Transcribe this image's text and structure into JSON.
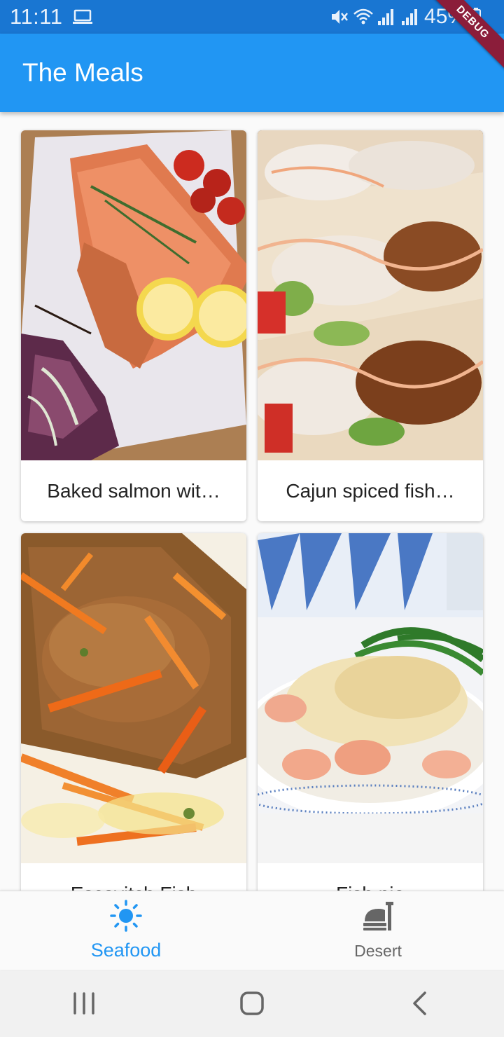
{
  "status_bar": {
    "time": "11:11",
    "battery": "45%"
  },
  "debug_banner": "DEBUG",
  "app_bar": {
    "title": "The Meals"
  },
  "meals": [
    {
      "title": "Baked salmon wit…",
      "image": "baked-salmon-photo"
    },
    {
      "title": "Cajun spiced fish…",
      "image": "fish-tacos-photo"
    },
    {
      "title": "Escovitch Fish",
      "image": "escovitch-fish-photo"
    },
    {
      "title": "Fish pie",
      "image": "fish-pie-photo"
    }
  ],
  "bottom_nav": {
    "items": [
      {
        "label": "Seafood",
        "icon": "sun-icon",
        "active": true
      },
      {
        "label": "Desert",
        "icon": "room-service-icon",
        "active": false
      }
    ]
  },
  "colors": {
    "status_bar": "#1976d2",
    "app_bar": "#2196f3",
    "active": "#2196f3",
    "inactive": "#666666",
    "debug_banner": "#8b1d3a"
  }
}
